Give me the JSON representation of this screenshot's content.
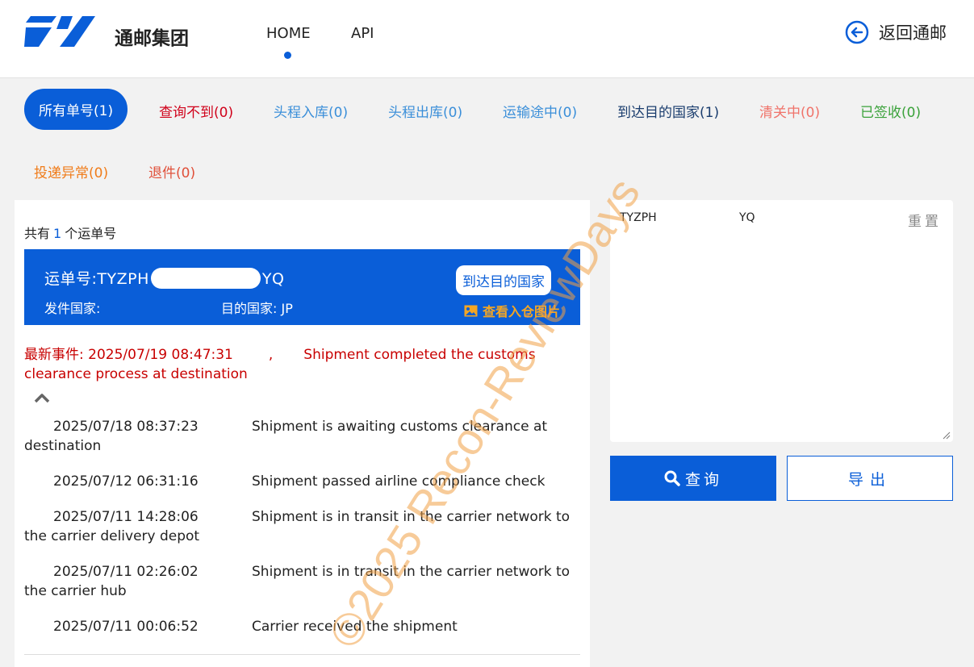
{
  "header": {
    "brand": "通邮集团",
    "nav": {
      "home": "HOME",
      "api": "API"
    },
    "back_label": "返回通邮"
  },
  "tabs": [
    {
      "label": "所有单号(1)",
      "color": "#ffffff",
      "active": true
    },
    {
      "label": "查询不到(0)",
      "color": "#d0021b"
    },
    {
      "label": "头程入库(0)",
      "color": "#3b8fd9"
    },
    {
      "label": "头程出库(0)",
      "color": "#3b8fd9"
    },
    {
      "label": "运输途中(0)",
      "color": "#3b8fd9"
    },
    {
      "label": "到达目的国家(1)",
      "color": "#1a3d6e"
    },
    {
      "label": "清关中(0)",
      "color": "#f0736a"
    },
    {
      "label": "已签收(0)",
      "color": "#3aa23a"
    },
    {
      "label": "投递异常(0)",
      "color": "#f07c1a"
    },
    {
      "label": "退件(0)",
      "color": "#e0503a"
    }
  ],
  "summary": {
    "prefix": "共有",
    "count": "1",
    "suffix": "个运单号"
  },
  "shipment": {
    "tracking_prefix": "运单号:TYZPH",
    "tracking_suffix": "YQ",
    "origin_label": "发件国家:",
    "dest_label": "目的国家: JP",
    "status_button": "到达目的国家",
    "photo_link": "查看入仓图片"
  },
  "latest_event": {
    "label": "最新事件: 2025/07/19 08:47:31",
    "separator": ",",
    "text": "Shipment completed the customs clearance process at destination"
  },
  "events": [
    {
      "time": "2025/07/18 08:37:23",
      "text": "Shipment is awaiting customs clearance at destination"
    },
    {
      "time": "2025/07/12 06:31:16",
      "text": "Shipment passed airline compliance check"
    },
    {
      "time": "2025/07/11 14:28:06",
      "text": "Shipment is in transit in the carrier network to the carrier delivery depot"
    },
    {
      "time": "2025/07/11 02:26:02",
      "text": "Shipment is in transit in the carrier network to the carrier hub"
    },
    {
      "time": "2025/07/11 00:06:52",
      "text": "Carrier received the shipment"
    }
  ],
  "query_panel": {
    "input_value_start": "TYZPH",
    "input_value_end": "YQ",
    "reset_label": "重置",
    "query_button": "查询",
    "export_button": "导出"
  },
  "watermark": "©2025 Recon-ReviewDays",
  "colors": {
    "primary": "#0a5ed8",
    "alert": "#c80000",
    "photo_link": "#f5a623"
  }
}
